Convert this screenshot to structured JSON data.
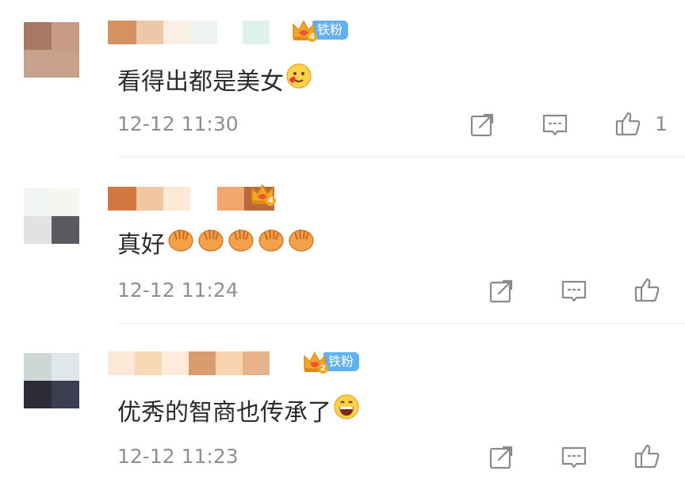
{
  "comments": [
    {
      "username_hidden": true,
      "crown_level": "4",
      "fan_badge": "铁粉",
      "text": "看得出都是美女",
      "emoji": "smiling-face-with-heart-icon",
      "time": "12-12 11:30",
      "likes": "1",
      "avatar_colors": [
        "#a87962",
        "#c89b86",
        "#c9a28e",
        "#c7a18a"
      ],
      "name_colors": [
        "#d3925f",
        "#ecc7a8",
        "#fbeee3",
        "#eef3f1",
        "#ddf2e8"
      ]
    },
    {
      "username_hidden": true,
      "crown_level": "4",
      "fan_badge": "",
      "text": "真好",
      "emoji": "clapping-hands-icon",
      "emoji_count": 5,
      "time": "12-12 11:24",
      "likes": "",
      "avatar_colors": [
        "#f2f6f2",
        "#f3f7ee",
        "#e2e2e2",
        "#5a5a60"
      ],
      "name_colors": [
        "#d07840",
        "#f1c6a2",
        "#fde9d6",
        "#f2a76f",
        "#b86a3d"
      ]
    },
    {
      "username_hidden": true,
      "crown_level": "2",
      "fan_badge": "铁粉",
      "text": "优秀的智商也传承了",
      "emoji": "grinning-face-icon",
      "time": "12-12 11:23",
      "likes": "",
      "avatar_colors": [
        "#cfd6d6",
        "#dfe6ec",
        "#2c2c38",
        "#3a3f52"
      ],
      "name_colors": [
        "#fbe8d6",
        "#f7d8b4",
        "#fdecd9",
        "#d99c6f",
        "#f8d5b0",
        "#e6b38b"
      ]
    }
  ],
  "actions": {
    "share": "share-icon",
    "comment": "comment-icon",
    "like": "thumbs-up-icon"
  },
  "colors": {
    "text": "#2b2b2b",
    "meta": "#8f8f8f",
    "fan_badge": "#63b0f0",
    "crown": "#f5a623"
  }
}
